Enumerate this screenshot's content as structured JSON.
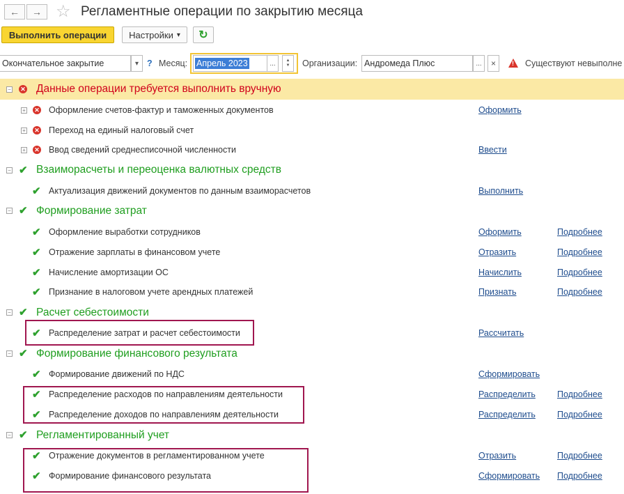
{
  "window": {
    "title": "Регламентные операции по закрытию месяца",
    "back_icon": "←",
    "forward_icon": "→",
    "favorite_icon": "☆"
  },
  "toolbar": {
    "run_label": "Выполнить операции",
    "settings_label": "Настройки",
    "settings_arrow": "▾",
    "refresh_icon": "↻"
  },
  "filters": {
    "mode_value": "Окончательное закрытие",
    "mode_arrow": "▾",
    "help": "?",
    "month_label": "Месяц:",
    "month_value": "Апрель 2023",
    "month_ellipsis": "...",
    "month_up": "▲",
    "month_down": "▼",
    "org_label": "Организации:",
    "org_value": "Андромеда Плюс",
    "org_ellipsis": "...",
    "org_clear": "×",
    "warning_icon": "!",
    "warning_text": "Существуют невыполне"
  },
  "groups": {
    "manual": {
      "title": "Данные операции требуется выполнить вручную",
      "items": [
        {
          "label": "Оформление счетов-фактур и таможенных документов",
          "action": "Оформить"
        },
        {
          "label": "Переход на единый налоговый счет"
        },
        {
          "label": "Ввод сведений среднесписочной численности",
          "action": "Ввести"
        }
      ]
    },
    "settlements": {
      "title": "Взаиморасчеты и переоценка валютных средств",
      "items": [
        {
          "label": "Актуализация движений документов по данным взаиморасчетов",
          "action": "Выполнить"
        }
      ]
    },
    "costs": {
      "title": "Формирование затрат",
      "items": [
        {
          "label": "Оформление выработки сотрудников",
          "action": "Оформить",
          "more": "Подробнее"
        },
        {
          "label": "Отражение зарплаты в финансовом учете",
          "action": "Отразить",
          "more": "Подробнее"
        },
        {
          "label": "Начисление амортизации ОС",
          "action": "Начислить",
          "more": "Подробнее"
        },
        {
          "label": "Признание в налоговом учете арендных платежей",
          "action": "Признать",
          "more": "Подробнее"
        }
      ]
    },
    "cost_price": {
      "title": "Расчет себестоимости",
      "items": [
        {
          "label": "Распределение затрат и расчет себестоимости",
          "action": "Рассчитать"
        }
      ]
    },
    "fin_result": {
      "title": "Формирование финансового результата",
      "items": [
        {
          "label": "Формирование движений по НДС",
          "action": "Сформировать"
        },
        {
          "label": "Распределение расходов по направлениям деятельности",
          "action": "Распределить",
          "more": "Подробнее"
        },
        {
          "label": "Распределение доходов по направлениям деятельности",
          "action": "Распределить",
          "more": "Подробнее"
        }
      ]
    },
    "regulated": {
      "title": "Регламентированный учет",
      "items": [
        {
          "label": "Отражение документов в регламентированном учете",
          "action": "Отразить",
          "more": "Подробнее"
        },
        {
          "label": "Формирование финансового результата",
          "action": "Сформировать",
          "more": "Подробнее"
        }
      ]
    }
  },
  "colors": {
    "error": "#d9342b",
    "success": "#2ea12e",
    "group_header_green": "#1f9e1f",
    "group_header_red": "#d0021b",
    "highlight_band": "#fbe9a5",
    "link": "#1e4c8d",
    "annotation_box": "#a0164f",
    "primary_button": "#f9d531"
  },
  "glyphs": {
    "expanded": "−",
    "collapsed": "+",
    "check": "✔",
    "cross": "✕"
  }
}
